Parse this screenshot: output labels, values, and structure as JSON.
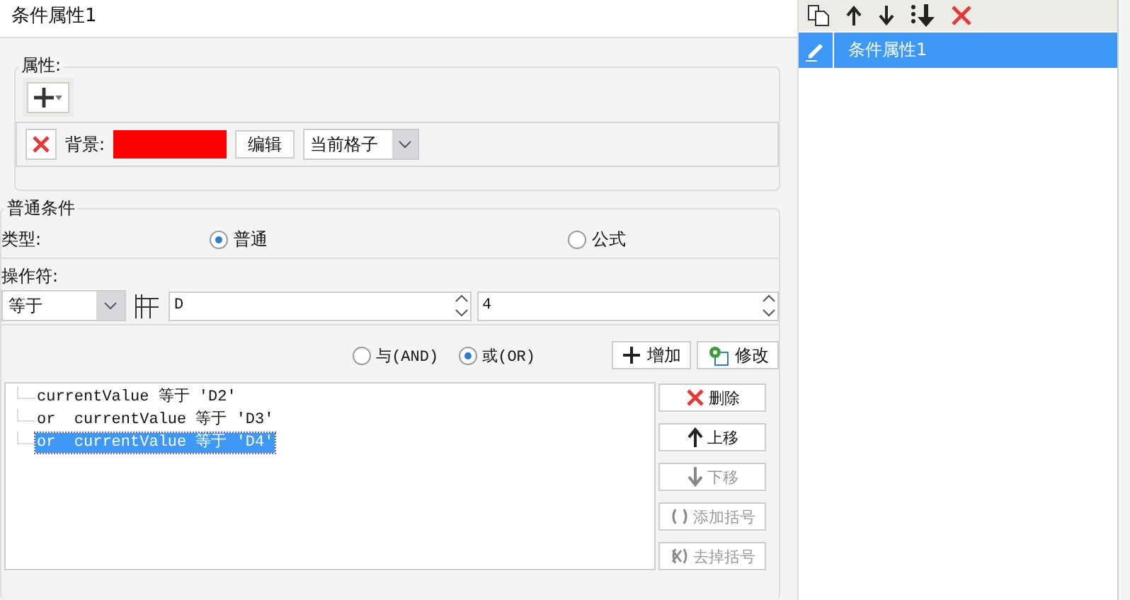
{
  "title": "条件属性1",
  "attributes": {
    "label": "属性:",
    "background_label": "背景:",
    "edit_button": "编辑",
    "scope": "当前格子"
  },
  "condition": {
    "label": "普通条件",
    "type_label": "类型:",
    "types": [
      {
        "label": "普通",
        "selected": true
      },
      {
        "label": "公式",
        "selected": false
      }
    ],
    "operator_label": "操作符:",
    "operator": "等于",
    "value_1": "D",
    "value_2": "4",
    "joins": [
      {
        "label": "与(AND)",
        "selected": false
      },
      {
        "label": "或(OR)",
        "selected": true
      }
    ],
    "add_button": "增加",
    "modify_button": "修改"
  },
  "conditions": [
    {
      "text": "currentValue 等于 'D2'",
      "selected": false
    },
    {
      "text": "or  currentValue 等于 'D3'",
      "selected": false
    },
    {
      "text": "or  currentValue 等于 'D4'",
      "selected": true
    }
  ],
  "actions": [
    {
      "kind": "delete",
      "label": "删除",
      "disabled": false
    },
    {
      "kind": "up",
      "label": "上移",
      "disabled": false
    },
    {
      "kind": "down",
      "label": "下移",
      "disabled": true
    },
    {
      "kind": "add-bracket",
      "label": "添加括号",
      "disabled": true
    },
    {
      "kind": "remove-bracket",
      "label": "去掉括号",
      "disabled": true
    }
  ],
  "list": [
    {
      "label": "条件属性1",
      "selected": true
    }
  ]
}
